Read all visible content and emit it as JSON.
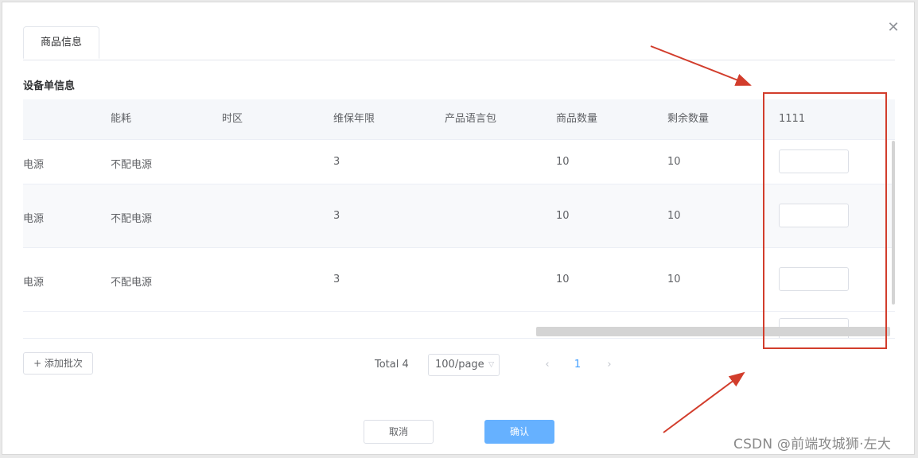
{
  "dialog": {
    "close_glyph": "✕",
    "tab_label": "商品信息",
    "section_title": "设备单信息"
  },
  "table": {
    "headers": [
      "能耗",
      "时区",
      "维保年限",
      "产品语言包",
      "商品数量",
      "剩余数量",
      "1111"
    ],
    "rows": [
      {
        "power": "电源",
        "energy": "不配电源",
        "timezone": "",
        "warranty": "3",
        "language_pack": "",
        "quantity": "10",
        "remaining": "10",
        "input_value": ""
      },
      {
        "power": "电源",
        "energy": "不配电源",
        "timezone": "",
        "warranty": "3",
        "language_pack": "",
        "quantity": "10",
        "remaining": "10",
        "input_value": ""
      },
      {
        "power": "电源",
        "energy": "不配电源",
        "timezone": "",
        "warranty": "3",
        "language_pack": "",
        "quantity": "10",
        "remaining": "10",
        "input_value": ""
      }
    ]
  },
  "footer": {
    "add_batch_label": "+ 添加批次",
    "total_label": "Total 4",
    "page_size_value": "100/page",
    "current_page": "1",
    "prev_glyph": "‹",
    "next_glyph": "›"
  },
  "actions": {
    "cancel_label": "取消",
    "confirm_label": "确认"
  },
  "annotation": {
    "highlight_color": "#d23d2c"
  },
  "watermark": "CSDN @前端攻城狮·左大"
}
